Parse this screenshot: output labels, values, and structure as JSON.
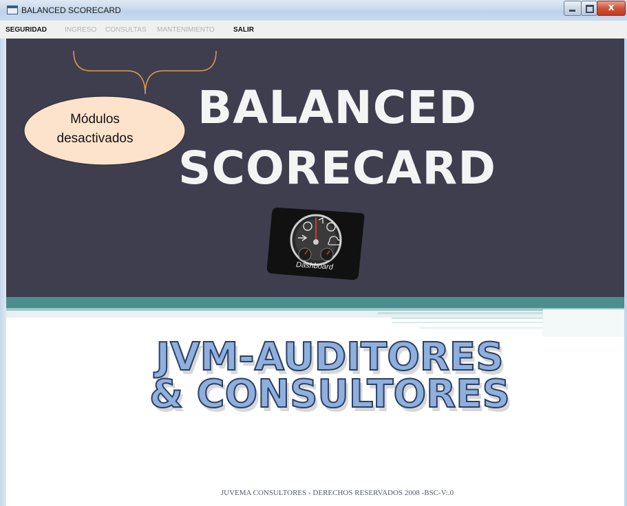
{
  "window": {
    "title": "BALANCED SCORECARD",
    "close_glyph": "x"
  },
  "menu": {
    "items": [
      {
        "label": "SEGURIDAD",
        "enabled": true
      },
      {
        "label": "INGRESO",
        "enabled": false
      },
      {
        "label": "CONSULTAS",
        "enabled": false
      },
      {
        "label": "MANTENIMIENTO",
        "enabled": false
      },
      {
        "label": "SALIR",
        "enabled": true
      }
    ]
  },
  "hero": {
    "title_line1": "BALANCED",
    "title_line2": "SCORECARD",
    "dashboard_label": "Dashboard"
  },
  "callout": {
    "line1": "Módulos",
    "line2": "desactivados"
  },
  "logo": {
    "line1": "JVM-AUDITORES",
    "line2": "& CONSULTORES"
  },
  "footer": {
    "text": "JUVEMA CONSULTORES - DERECHOS RESERVADOS 2008 -BSC-V:.0"
  },
  "colors": {
    "panel": "#3f3e4f",
    "teal": "#4a8f8e",
    "callout_fill": "#fde3cc",
    "callout_stroke": "#e29a4e",
    "logo_fill": "#8fb0dc"
  },
  "icons": [
    "app-icon",
    "minimize-icon",
    "maximize-icon",
    "close-icon",
    "dashboard-icon"
  ]
}
